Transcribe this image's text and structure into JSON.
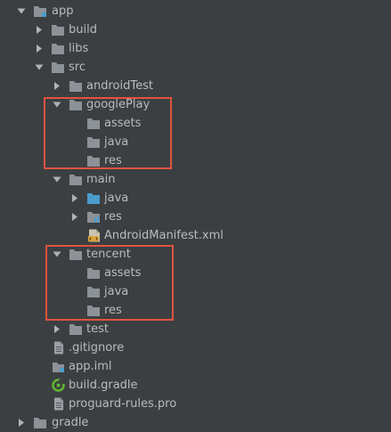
{
  "tree": {
    "items": [
      {
        "label": "app",
        "icon": "module-folder-icon",
        "expanded": true
      },
      {
        "label": "build",
        "icon": "folder-icon",
        "expanded": false
      },
      {
        "label": "libs",
        "icon": "folder-icon",
        "expanded": false
      },
      {
        "label": "src",
        "icon": "folder-icon",
        "expanded": true
      },
      {
        "label": "androidTest",
        "icon": "folder-icon",
        "expanded": false
      },
      {
        "label": "googlePlay",
        "icon": "folder-icon",
        "expanded": true
      },
      {
        "label": "assets",
        "icon": "folder-icon"
      },
      {
        "label": "java",
        "icon": "folder-icon"
      },
      {
        "label": "res",
        "icon": "folder-icon"
      },
      {
        "label": "main",
        "icon": "folder-icon",
        "expanded": true
      },
      {
        "label": "java",
        "icon": "source-folder-icon",
        "expanded": false
      },
      {
        "label": "res",
        "icon": "resource-folder-icon",
        "expanded": false
      },
      {
        "label": "AndroidManifest.xml",
        "icon": "xml-file-icon"
      },
      {
        "label": "tencent",
        "icon": "folder-icon",
        "expanded": true
      },
      {
        "label": "assets",
        "icon": "folder-icon"
      },
      {
        "label": "java",
        "icon": "folder-icon"
      },
      {
        "label": "res",
        "icon": "folder-icon"
      },
      {
        "label": "test",
        "icon": "folder-icon",
        "expanded": false
      },
      {
        "label": ".gitignore",
        "icon": "text-file-icon"
      },
      {
        "label": "app.iml",
        "icon": "iml-file-icon"
      },
      {
        "label": "build.gradle",
        "icon": "gradle-file-icon"
      },
      {
        "label": "proguard-rules.pro",
        "icon": "text-file-icon"
      },
      {
        "label": "gradle",
        "icon": "folder-icon",
        "expanded": false
      }
    ]
  },
  "colors": {
    "background": "#3c3f41",
    "text": "#bbbbbb",
    "folder": "#8c9297",
    "source_folder": "#4a9ccc",
    "highlight": "#e0533f",
    "gradle": "#5fb832"
  }
}
